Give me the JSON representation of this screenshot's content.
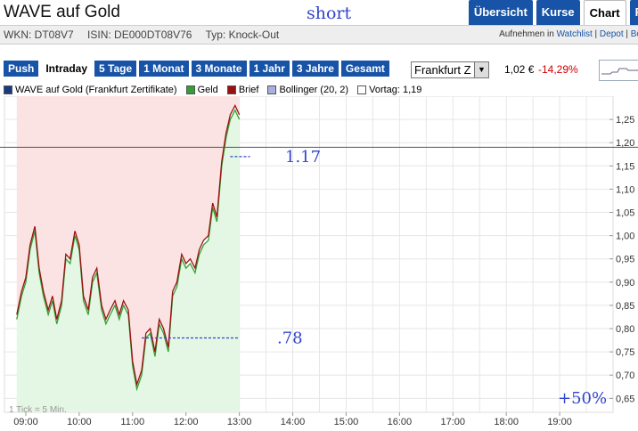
{
  "header": {
    "title": "WAVE auf Gold",
    "annotation_top": "short",
    "tabs": [
      {
        "label": "Übersicht",
        "active": false
      },
      {
        "label": "Kurse",
        "active": false
      },
      {
        "label": "Chart",
        "active": true
      },
      {
        "label": "R",
        "active": false
      }
    ]
  },
  "meta": {
    "wkn": "WKN: DT08V7",
    "isin": "ISIN: DE000DT08V76",
    "type": "Typ: Knock-Out",
    "links_prefix": "Aufnehmen in",
    "links": [
      "Watchlist",
      "Depot",
      "Bö"
    ]
  },
  "ranges": [
    {
      "label": "Push",
      "active": false
    },
    {
      "label": "Intraday",
      "active": true
    },
    {
      "label": "5 Tage",
      "active": false
    },
    {
      "label": "1 Monat",
      "active": false
    },
    {
      "label": "3 Monate",
      "active": false
    },
    {
      "label": "1 Jahr",
      "active": false
    },
    {
      "label": "3 Jahre",
      "active": false
    },
    {
      "label": "Gesamt",
      "active": false
    }
  ],
  "exchange": {
    "selected": "Frankfurt Z",
    "arrow": "▼"
  },
  "quote": {
    "price": "1,02 €",
    "change": "-14,29%"
  },
  "legend": [
    {
      "label": "WAVE auf Gold  (Frankfurt Zertifikate)",
      "color": "#1a3a80"
    },
    {
      "label": "Geld",
      "color": "#33a033"
    },
    {
      "label": "Brief",
      "color": "#991111"
    },
    {
      "label": "Bollinger (20, 2)",
      "color": "#aab0dd"
    },
    {
      "label": "Vortag: 1,19",
      "color": "#ffffff"
    }
  ],
  "chart_data": {
    "type": "line",
    "x_ticks": [
      "09:00",
      "10:00",
      "11:00",
      "12:00",
      "13:00",
      "14:00",
      "15:00",
      "16:00",
      "17:00",
      "18:00",
      "19:00"
    ],
    "y_ticks": [
      "1,25",
      "1,20",
      "1,15",
      "1,10",
      "1,05",
      "1,00",
      "0,95",
      "0,90",
      "0,85",
      "0,80",
      "0,75",
      "0,70",
      "0,65"
    ],
    "ylim": [
      0.62,
      1.3
    ],
    "x_range_hours": [
      8.6,
      20.0
    ],
    "previous_close": 1.19,
    "tick_note": "1 Tick = 5 Min.",
    "annotations": [
      {
        "text": "1.17",
        "value": 1.17
      },
      {
        "text": ".78",
        "value": 0.78
      },
      {
        "text": "+50%"
      }
    ],
    "series": [
      {
        "name": "Brief",
        "color": "#991111",
        "points": [
          [
            8.83,
            0.83
          ],
          [
            8.92,
            0.88
          ],
          [
            9.0,
            0.91
          ],
          [
            9.08,
            0.98
          ],
          [
            9.17,
            1.02
          ],
          [
            9.25,
            0.93
          ],
          [
            9.33,
            0.88
          ],
          [
            9.42,
            0.84
          ],
          [
            9.5,
            0.87
          ],
          [
            9.58,
            0.82
          ],
          [
            9.67,
            0.86
          ],
          [
            9.75,
            0.96
          ],
          [
            9.83,
            0.95
          ],
          [
            9.92,
            1.01
          ],
          [
            10.0,
            0.98
          ],
          [
            10.08,
            0.87
          ],
          [
            10.17,
            0.84
          ],
          [
            10.25,
            0.91
          ],
          [
            10.33,
            0.93
          ],
          [
            10.42,
            0.85
          ],
          [
            10.5,
            0.82
          ],
          [
            10.58,
            0.84
          ],
          [
            10.67,
            0.86
          ],
          [
            10.75,
            0.83
          ],
          [
            10.83,
            0.86
          ],
          [
            10.92,
            0.84
          ],
          [
            11.0,
            0.73
          ],
          [
            11.08,
            0.68
          ],
          [
            11.17,
            0.71
          ],
          [
            11.25,
            0.79
          ],
          [
            11.33,
            0.8
          ],
          [
            11.42,
            0.75
          ],
          [
            11.5,
            0.82
          ],
          [
            11.58,
            0.8
          ],
          [
            11.67,
            0.76
          ],
          [
            11.75,
            0.88
          ],
          [
            11.83,
            0.9
          ],
          [
            11.92,
            0.96
          ],
          [
            12.0,
            0.94
          ],
          [
            12.08,
            0.95
          ],
          [
            12.17,
            0.93
          ],
          [
            12.25,
            0.97
          ],
          [
            12.33,
            0.99
          ],
          [
            12.42,
            1.0
          ],
          [
            12.5,
            1.07
          ],
          [
            12.58,
            1.04
          ],
          [
            12.67,
            1.16
          ],
          [
            12.75,
            1.22
          ],
          [
            12.83,
            1.26
          ],
          [
            12.92,
            1.28
          ],
          [
            13.0,
            1.26
          ]
        ]
      },
      {
        "name": "Geld",
        "color": "#33a033",
        "points": [
          [
            8.83,
            0.82
          ],
          [
            8.92,
            0.87
          ],
          [
            9.0,
            0.9
          ],
          [
            9.08,
            0.97
          ],
          [
            9.17,
            1.01
          ],
          [
            9.25,
            0.92
          ],
          [
            9.33,
            0.87
          ],
          [
            9.42,
            0.83
          ],
          [
            9.5,
            0.86
          ],
          [
            9.58,
            0.81
          ],
          [
            9.67,
            0.85
          ],
          [
            9.75,
            0.95
          ],
          [
            9.83,
            0.94
          ],
          [
            9.92,
            1.0
          ],
          [
            10.0,
            0.97
          ],
          [
            10.08,
            0.86
          ],
          [
            10.17,
            0.83
          ],
          [
            10.25,
            0.9
          ],
          [
            10.33,
            0.92
          ],
          [
            10.42,
            0.84
          ],
          [
            10.5,
            0.81
          ],
          [
            10.58,
            0.83
          ],
          [
            10.67,
            0.85
          ],
          [
            10.75,
            0.82
          ],
          [
            10.83,
            0.85
          ],
          [
            10.92,
            0.83
          ],
          [
            11.0,
            0.72
          ],
          [
            11.08,
            0.67
          ],
          [
            11.17,
            0.7
          ],
          [
            11.25,
            0.78
          ],
          [
            11.33,
            0.79
          ],
          [
            11.42,
            0.74
          ],
          [
            11.5,
            0.81
          ],
          [
            11.58,
            0.79
          ],
          [
            11.67,
            0.75
          ],
          [
            11.75,
            0.87
          ],
          [
            11.83,
            0.89
          ],
          [
            11.92,
            0.95
          ],
          [
            12.0,
            0.93
          ],
          [
            12.08,
            0.94
          ],
          [
            12.17,
            0.92
          ],
          [
            12.25,
            0.96
          ],
          [
            12.33,
            0.98
          ],
          [
            12.42,
            0.99
          ],
          [
            12.5,
            1.06
          ],
          [
            12.58,
            1.03
          ],
          [
            12.67,
            1.15
          ],
          [
            12.75,
            1.21
          ],
          [
            12.83,
            1.25
          ],
          [
            12.92,
            1.27
          ],
          [
            13.0,
            1.25
          ]
        ]
      }
    ]
  }
}
